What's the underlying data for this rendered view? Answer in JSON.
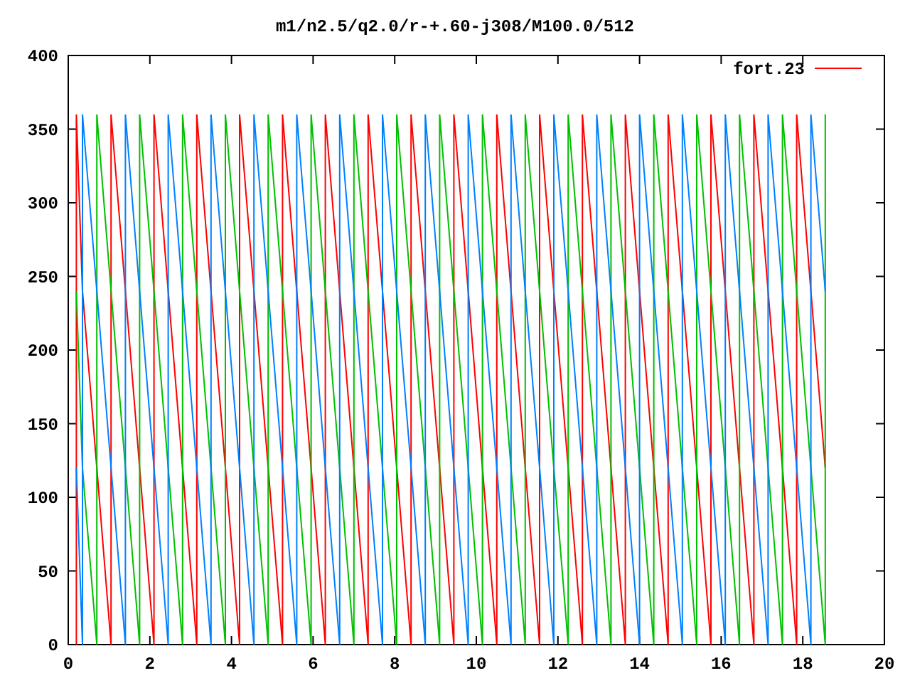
{
  "plot": {
    "chart_data": {
      "type": "line",
      "title": "m1/n2.5/q2.0/r-+.60-j308/M100.0/512",
      "x": [
        0.2,
        0.2,
        0.35,
        0.35,
        0.7,
        0.7,
        1.05,
        1.05,
        1.4,
        1.4,
        1.75,
        1.75,
        2.1,
        2.1,
        2.45,
        2.45,
        2.8,
        2.8,
        3.15,
        3.15,
        3.5,
        3.5,
        3.85,
        3.85,
        4.2,
        4.2,
        4.55,
        4.55,
        4.9,
        4.9,
        5.25,
        5.25,
        5.6,
        5.6,
        5.95,
        5.95,
        6.3,
        6.3,
        6.65,
        6.65,
        7,
        7,
        7.35,
        7.35,
        7.7,
        7.7,
        8.05,
        8.05,
        8.4,
        8.4,
        8.75,
        8.75,
        9.1,
        9.1,
        9.45,
        9.45,
        9.8,
        9.8,
        10.15,
        10.15,
        10.5,
        10.5,
        10.85,
        10.85,
        11.2,
        11.2,
        11.55,
        11.55,
        11.9,
        11.9,
        12.25,
        12.25,
        12.6,
        12.6,
        12.95,
        12.95,
        13.3,
        13.3,
        13.65,
        13.65,
        14,
        14,
        14.35,
        14.35,
        14.7,
        14.7,
        15.05,
        15.05,
        15.4,
        15.4,
        15.75,
        15.75,
        16.1,
        16.1,
        16.45,
        16.45,
        16.8,
        16.8,
        17.15,
        17.15,
        17.5,
        17.5,
        17.85,
        17.85,
        18.2,
        18.2,
        18.55,
        18.55
      ],
      "series": [
        {
          "name": "fort.23",
          "color": "#ff0000",
          "values": [
            0,
            360,
            240,
            240,
            120,
            120,
            0,
            360,
            240,
            240,
            120,
            120,
            0,
            360,
            240,
            240,
            120,
            120,
            0,
            360,
            240,
            240,
            120,
            120,
            0,
            360,
            240,
            240,
            120,
            120,
            0,
            360,
            240,
            240,
            120,
            120,
            0,
            360,
            240,
            240,
            120,
            120,
            0,
            360,
            240,
            240,
            120,
            120,
            0,
            360,
            240,
            240,
            120,
            120,
            0,
            360,
            240,
            240,
            120,
            120,
            0,
            360,
            240,
            240,
            120,
            120,
            0,
            360,
            240,
            240,
            120,
            120,
            0,
            360,
            240,
            240,
            120,
            120,
            0,
            360,
            240,
            240,
            120,
            120,
            0,
            360,
            240,
            240,
            120,
            120,
            0,
            360,
            240,
            240,
            120,
            120,
            0,
            360,
            240,
            240,
            120,
            120,
            0,
            360,
            240,
            240,
            120,
            120
          ]
        },
        {
          "color": "#00c000",
          "values": [
            240,
            240,
            120,
            120,
            0,
            360,
            240,
            240,
            120,
            120,
            0,
            360,
            240,
            240,
            120,
            120,
            0,
            360,
            240,
            240,
            120,
            120,
            0,
            360,
            240,
            240,
            120,
            120,
            0,
            360,
            240,
            240,
            120,
            120,
            0,
            360,
            240,
            240,
            120,
            120,
            0,
            360,
            240,
            240,
            120,
            120,
            0,
            360,
            240,
            240,
            120,
            120,
            0,
            360,
            240,
            240,
            120,
            120,
            0,
            360,
            240,
            240,
            120,
            120,
            0,
            360,
            240,
            240,
            120,
            120,
            0,
            360,
            240,
            240,
            120,
            120,
            0,
            360,
            240,
            240,
            120,
            120,
            0,
            360,
            240,
            240,
            120,
            120,
            0,
            360,
            240,
            240,
            120,
            120,
            0,
            360,
            240,
            240,
            120,
            120,
            0,
            360,
            240,
            240,
            120,
            120,
            0,
            360
          ]
        },
        {
          "color": "#0080ff",
          "values": [
            120,
            120,
            0,
            360,
            240,
            240,
            120,
            120,
            0,
            360,
            240,
            240,
            120,
            120,
            0,
            360,
            240,
            240,
            120,
            120,
            0,
            360,
            240,
            240,
            120,
            120,
            0,
            360,
            240,
            240,
            120,
            120,
            0,
            360,
            240,
            240,
            120,
            120,
            0,
            360,
            240,
            240,
            120,
            120,
            0,
            360,
            240,
            240,
            120,
            120,
            0,
            360,
            240,
            240,
            120,
            120,
            0,
            360,
            240,
            240,
            120,
            120,
            0,
            360,
            240,
            240,
            120,
            120,
            0,
            360,
            240,
            240,
            120,
            120,
            0,
            360,
            240,
            240,
            120,
            120,
            0,
            360,
            240,
            240,
            120,
            120,
            0,
            360,
            240,
            240,
            120,
            120,
            0,
            360,
            240,
            240,
            120,
            120,
            0,
            360,
            240,
            240,
            120,
            120,
            0,
            360,
            240,
            240
          ]
        }
      ],
      "xlim": [
        0,
        20
      ],
      "ylim": [
        0,
        400
      ],
      "xticks": [
        0,
        2,
        4,
        6,
        8,
        10,
        12,
        14,
        16,
        18,
        20
      ],
      "yticks": [
        0,
        50,
        100,
        150,
        200,
        250,
        300,
        350,
        400
      ]
    }
  }
}
